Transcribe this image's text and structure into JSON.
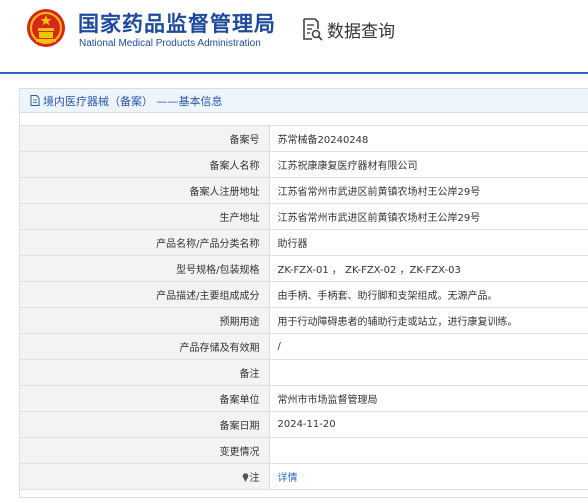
{
  "header": {
    "title_cn": "国家药品监督管理局",
    "title_en": "National Medical Products Administration",
    "query_label": "数据查询"
  },
  "breadcrumb": "境内医疗器械（备案） ——基本信息",
  "rows": [
    {
      "label": "备案号",
      "value": "苏常械备20240248"
    },
    {
      "label": "备案人名称",
      "value": "江苏祝康康复医疗器材有限公司"
    },
    {
      "label": "备案人注册地址",
      "value": "江苏省常州市武进区前黄镇农场村王公岸29号"
    },
    {
      "label": "生产地址",
      "value": "江苏省常州市武进区前黄镇农场村王公岸29号"
    },
    {
      "label": "产品名称/产品分类名称",
      "value": "助行器"
    },
    {
      "label": "型号规格/包装规格",
      "value": "ZK-FZX-01 ， ZK-FZX-02 ，ZK-FZX-03"
    },
    {
      "label": "产品描述/主要组成成分",
      "value": "由手柄、手柄套、助行脚和支架组成。无源产品。"
    },
    {
      "label": "预期用途",
      "value": "用于行动障碍患者的辅助行走或站立，进行康复训练。"
    },
    {
      "label": "产品存储及有效期",
      "value": "/"
    },
    {
      "label": "备注",
      "value": ""
    },
    {
      "label": "备案单位",
      "value": "常州市市场监督管理局"
    },
    {
      "label": "备案日期",
      "value": "2024-11-20"
    },
    {
      "label": "变更情况",
      "value": ""
    }
  ],
  "note": {
    "label": "注",
    "link": "详情"
  },
  "colors": {
    "brand": "#1e4a9c",
    "accent": "#2f67b8",
    "label_bg": "#f3f3f3"
  }
}
